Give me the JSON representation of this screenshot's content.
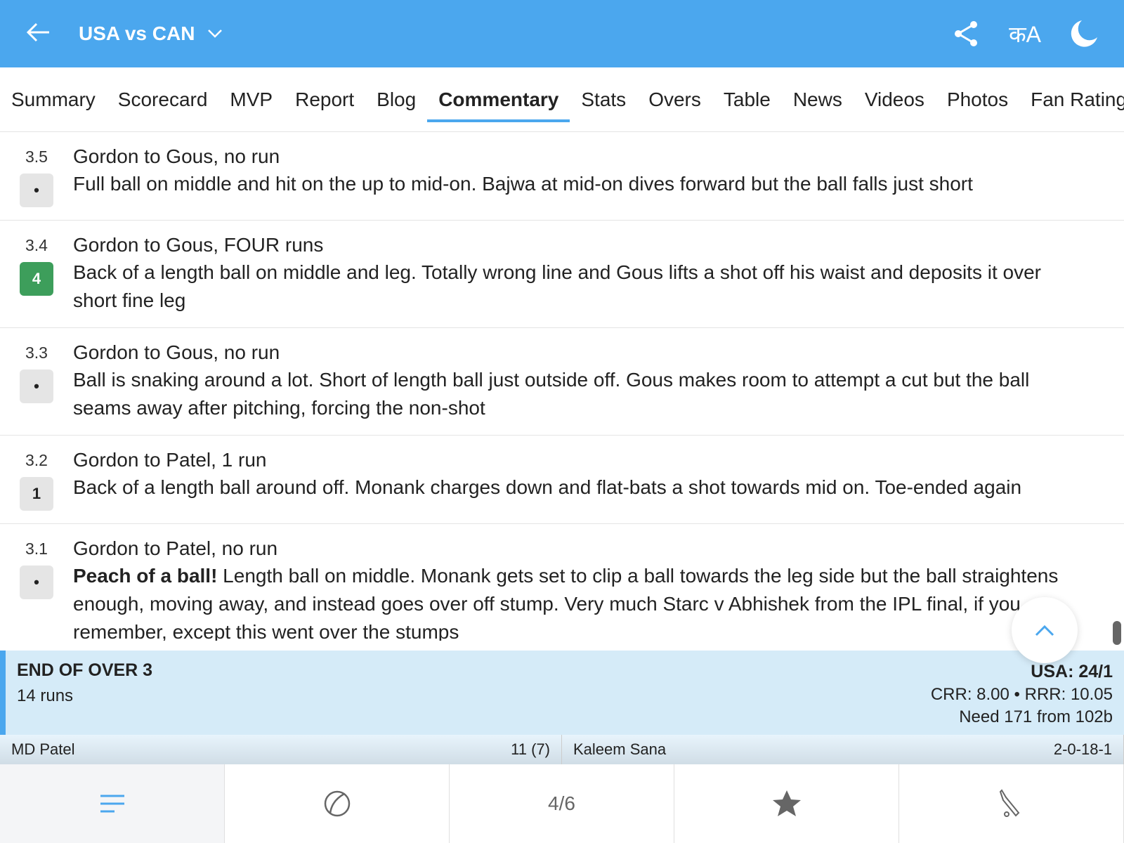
{
  "header": {
    "title": "USA vs CAN",
    "lang_label": "कA"
  },
  "tabs": [
    "Summary",
    "Scorecard",
    "MVP",
    "Report",
    "Blog",
    "Commentary",
    "Stats",
    "Overs",
    "Table",
    "News",
    "Videos",
    "Photos",
    "Fan Ratings"
  ],
  "balls": [
    {
      "over": "3.5",
      "result": "•",
      "head": "Gordon to Gous, no run",
      "bold": "",
      "text": "Full ball on middle and hit on the up to mid-on. Bajwa at mid-on dives forward but the ball falls just short"
    },
    {
      "over": "3.4",
      "result": "4",
      "head": "Gordon to Gous, FOUR runs",
      "bold": "",
      "text": "Back of a length ball on middle and leg. Totally wrong line and Gous lifts a shot off his waist and deposits it over short fine leg"
    },
    {
      "over": "3.3",
      "result": "•",
      "head": "Gordon to Gous, no run",
      "bold": "",
      "text": "Ball is snaking around a lot. Short of length ball just outside off. Gous makes room to attempt a cut but the ball seams away after pitching, forcing the non-shot"
    },
    {
      "over": "3.2",
      "result": "1",
      "head": "Gordon to Patel, 1 run",
      "bold": "",
      "text": "Back of a length ball around off. Monank charges down and flat-bats a shot towards mid on. Toe-ended again"
    },
    {
      "over": "3.1",
      "result": "•",
      "head": "Gordon to Patel, no run",
      "bold": "Peach of a ball!",
      "text": " Length ball on middle. Monank gets set to clip a ball towards the leg side but the ball straightens enough, moving away, and instead goes over off stump. Very much Starc v Abhishek from the IPL final, if you remember, except this went over the stumps"
    }
  ],
  "end_of_over": {
    "title": "END OF OVER 3",
    "runs": "14 runs",
    "score": "USA: 24/1",
    "rates": "CRR: 8.00 • RRR: 10.05",
    "need": "Need 171 from 102b"
  },
  "batter": {
    "name": "MD Patel",
    "score": "11 (7)"
  },
  "bowler": {
    "name": "Kaleem Sana",
    "figures": "2-0-18-1"
  },
  "bottom_nav": {
    "page": "4/6"
  }
}
